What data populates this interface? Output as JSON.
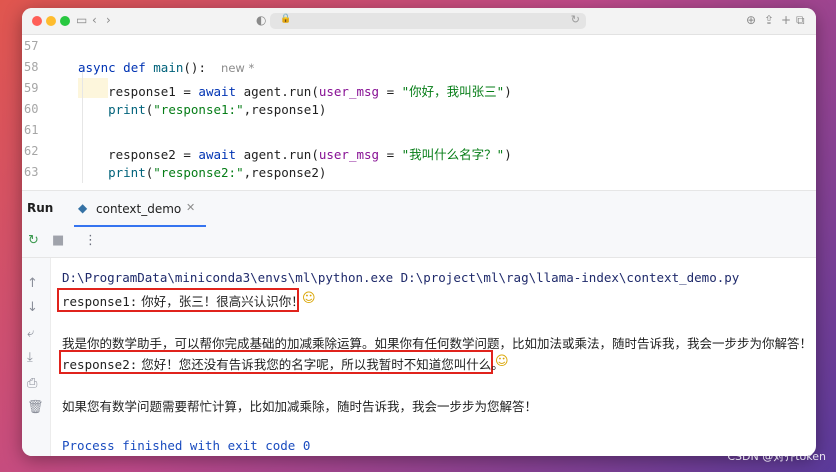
{
  "browser": {
    "nav_back": "‹",
    "nav_forward": "›",
    "shield": "◐",
    "lock": "🔒",
    "refresh": "↻",
    "right_icons": [
      "⊕",
      "⇪",
      "+",
      "⧉"
    ]
  },
  "editor": {
    "lines": [
      {
        "num": "57"
      },
      {
        "num": "58",
        "kw1": "async",
        "kw2": "def",
        "fn": "main",
        "rest": "():",
        "hint": "new *"
      },
      {
        "num": "59",
        "pre": "    response1 = ",
        "kw": "await",
        "mid": " agent.run(",
        "param": "user_msg",
        "eq": " = ",
        "str": "\"你好，我叫张三\"",
        "end": ")"
      },
      {
        "num": "60",
        "pre": "    ",
        "fn": "print",
        "open": "(",
        "str": "\"response1:\"",
        "end": ",response1)"
      },
      {
        "num": "61"
      },
      {
        "num": "62",
        "pre": "    response2 = ",
        "kw": "await",
        "mid": " agent.run(",
        "param": "user_msg",
        "eq": " = ",
        "str": "\"我叫什么名字？\"",
        "end": ")"
      },
      {
        "num": "63",
        "pre": "    ",
        "fn": "print",
        "open": "(",
        "str": "\"response2:\"",
        "end": ",response2)"
      }
    ]
  },
  "run_panel": {
    "title": "Run",
    "tab_label": "context_demo",
    "tab_close": "✕",
    "toolbar_icons": [
      "↻",
      "■",
      "⋮"
    ]
  },
  "console": {
    "cmd": "D:\\ProgramData\\miniconda3\\envs\\ml\\python.exe D:\\project\\ml\\rag\\llama-index\\context_demo.py",
    "response1_label": "response1:",
    "response1_text": " 你好，张三！很高兴认识你！",
    "emoji": "☺",
    "line_intro": "我是你的数学助手，可以帮你完成基础的加减乘除运算。如果你有任何数学问题，比如加法或乘法，随时告诉我，我会一步步为你解答！",
    "response2_label": "response2:",
    "response2_text": " 您好！您还没有告诉我您的名字呢，所以我暂时不知道您叫什么。",
    "line_help": "如果您有数学问题需要帮忙计算，比如加减乘除，随时告诉我，我会一步步为您解答！",
    "finished": "Process finished with exit code 0"
  },
  "watermark": "CSDN @对齐token",
  "colors": {
    "keyword": "#0033b3",
    "string": "#067d17",
    "highlight_box": "#e0231c",
    "tab_underline": "#3574f0"
  }
}
